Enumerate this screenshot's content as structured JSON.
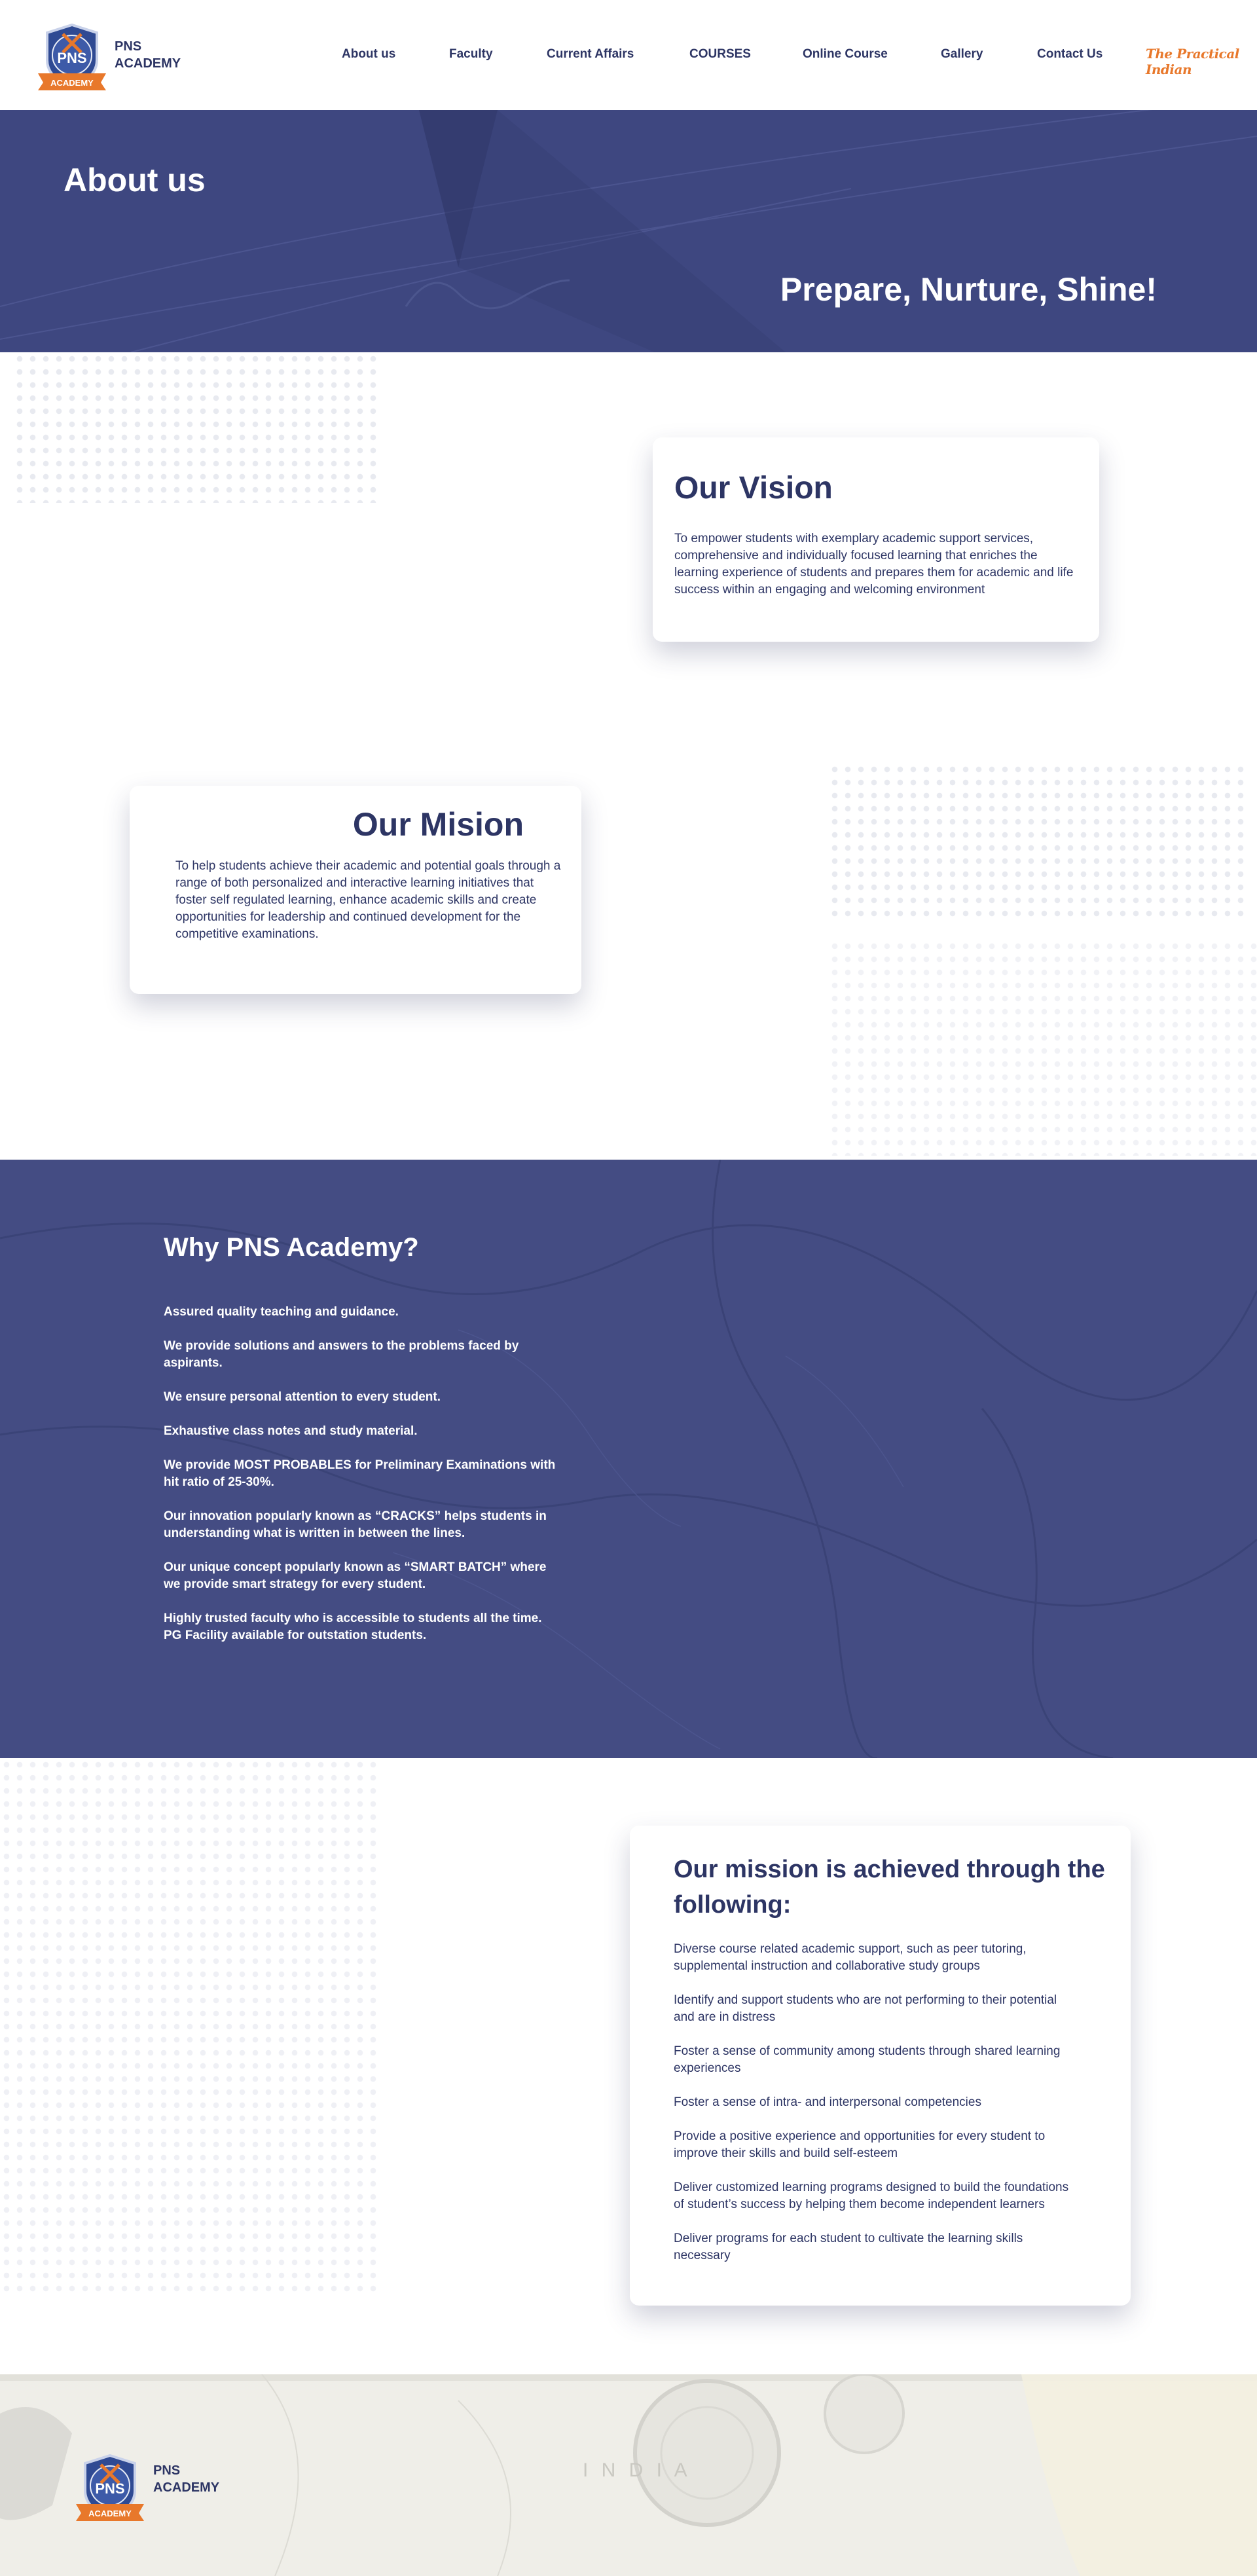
{
  "header": {
    "brand_line1": "PNS",
    "brand_line2": "ACADEMY",
    "logo_text": "PNS",
    "logo_banner": "ACADEMY",
    "nav": {
      "about": "About us",
      "faculty": "Faculty",
      "current_affairs": "Current Affairs",
      "courses": "COURSES",
      "online_course": "Online Course",
      "gallery": "Gallery",
      "contact": "Contact Us"
    },
    "partner": "The Practical Indian"
  },
  "hero": {
    "title": "About us",
    "tagline": "Prepare, Nurture, Shine!"
  },
  "vision": {
    "title": "Our Vision",
    "text": "To empower students with exemplary academic support services, comprehensive and individually focused learning that enriches the learning experience of students and prepares them for academic and life success within an engaging and welcoming environment"
  },
  "mission": {
    "title": "Our Mision",
    "text": " To help students achieve their academic and potential goals through a range of both personalized and interactive learning initiatives that foster self regulated learning, enhance academic skills and create opportunities for leadership and continued development for the competitive examinations."
  },
  "why": {
    "title": "Why PNS Academy?",
    "items": [
      "Assured quality teaching and guidance.",
      "We provide solutions and answers to the problems faced by aspirants.",
      "We ensure personal attention to every student.",
      "Exhaustive class notes and study material.",
      "We provide MOST PROBABLES for Preliminary Examinations with hit ratio of 25-30%.",
      "Our innovation popularly known as “CRACKS” helps students in understanding what is written in between the lines.",
      "Our unique concept popularly known as “SMART BATCH” where we provide smart strategy for every student.",
      "Highly trusted faculty who is accessible to students all the time. PG Facility available for outstation students."
    ]
  },
  "achieved": {
    "title": "Our mission is achieved through the following:",
    "items": [
      "Diverse course related academic support, such as peer tutoring, supplemental instruction and collaborative study groups",
      "Identify and support students who are not performing to their potential and are in distress",
      "Foster a sense of community among students through shared learning experiences",
      "Foster a sense of intra- and interpersonal competencies",
      "Provide a positive experience and opportunities for every student to improve their skills and build self-esteem",
      "Deliver customized learning programs designed to build the foundations of student’s success by helping them become independent learners",
      "Deliver programs for each student to cultivate the learning skills necessary"
    ]
  },
  "footer": {
    "brand_line1": "PNS",
    "brand_line2": "ACADEMY",
    "map_label": "I N D I A"
  },
  "colors": {
    "navy": "#2d3564",
    "hero_bg": "#3e4780",
    "why_bg": "#444c83",
    "accent_orange": "#e8782b"
  }
}
